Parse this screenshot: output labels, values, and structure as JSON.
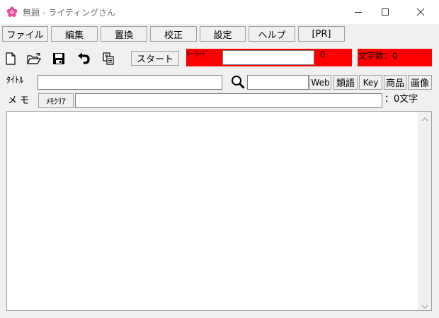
{
  "window": {
    "title": "無題 - ライティングさん",
    "app_icon": "pink-flower-icon",
    "controls": [
      "minimize-icon",
      "maximize-icon",
      "close-icon"
    ]
  },
  "menu": {
    "items": [
      {
        "label": "ファイル"
      },
      {
        "label": "編集"
      },
      {
        "label": "置換"
      },
      {
        "label": "校正"
      },
      {
        "label": "設定"
      },
      {
        "label": "ヘルプ"
      },
      {
        "label": "[PR]"
      }
    ]
  },
  "toolbar": {
    "icons": [
      "new-file-icon",
      "open-folder-icon",
      "save-icon",
      "undo-icon",
      "copy-icon"
    ],
    "start_label": "スタート",
    "keyword_label": "ｷｰﾜｰﾄﾞ",
    "keyword_value": "",
    "keyword_count": "0",
    "char_count_label": "文字数：0"
  },
  "title_row": {
    "label": "ﾀｲﾄﾙ",
    "title_value": "",
    "search_value": "",
    "web_button": "Web",
    "thesaurus_button": "類語",
    "key_button": "Key",
    "product_button": "商品",
    "image_button": "画像"
  },
  "memo_row": {
    "label": "メ モ",
    "clear_button": "ﾒﾓｸﾘｱ",
    "memo_value": "",
    "memo_count": "：0文字"
  },
  "editor": {
    "value": ""
  },
  "colors": {
    "highlight": "#ff0000",
    "window_bg": "#f0f0f0",
    "title_text": "#6d6d6d"
  }
}
